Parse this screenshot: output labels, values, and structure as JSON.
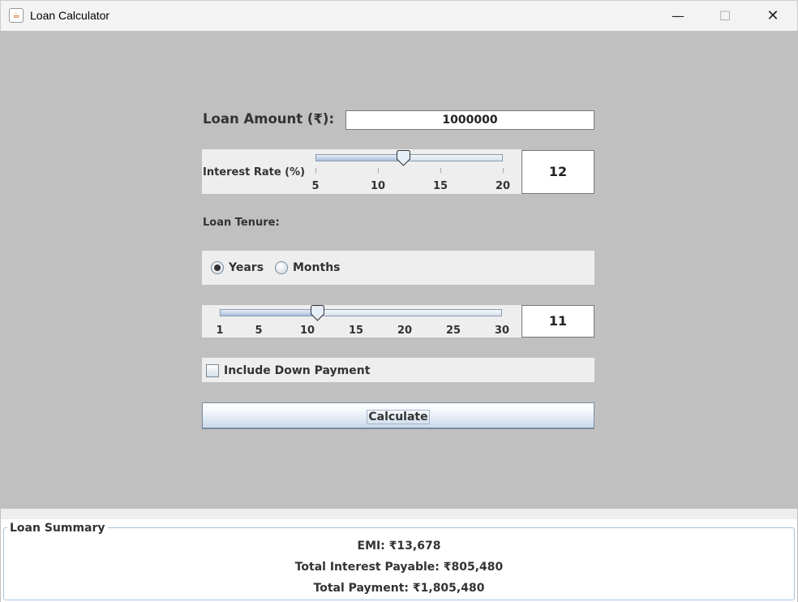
{
  "window": {
    "title": "Loan Calculator",
    "minimize_icon": "minimize-icon",
    "maximize_icon": "maximize-icon",
    "close_icon": "close-icon"
  },
  "loan_amount": {
    "label": "Loan Amount (₹):",
    "value": "1000000"
  },
  "interest_rate": {
    "label": "Interest Rate (%)",
    "min": 5,
    "max": 20,
    "value": 12,
    "display": "12",
    "ticks": [
      "5",
      "10",
      "15",
      "20"
    ]
  },
  "tenure": {
    "label": "Loan Tenure:",
    "options": [
      {
        "label": "Years",
        "selected": true
      },
      {
        "label": "Months",
        "selected": false
      }
    ],
    "min": 1,
    "max": 30,
    "value": 11,
    "display": "11",
    "ticks": [
      "1",
      "5",
      "10",
      "15",
      "20",
      "25",
      "30"
    ]
  },
  "down_payment": {
    "label": "Include Down Payment",
    "checked": false
  },
  "calculate_label": "Calculate",
  "summary": {
    "title": "Loan Summary",
    "emi": "EMI: ₹13,678",
    "total_interest": "Total Interest Payable: ₹805,480",
    "total_payment": "Total Payment: ₹1,805,480"
  },
  "colors": {
    "background": "#c0c0c0",
    "panel": "#eeeeee",
    "border_accent": "#a6c4de"
  }
}
